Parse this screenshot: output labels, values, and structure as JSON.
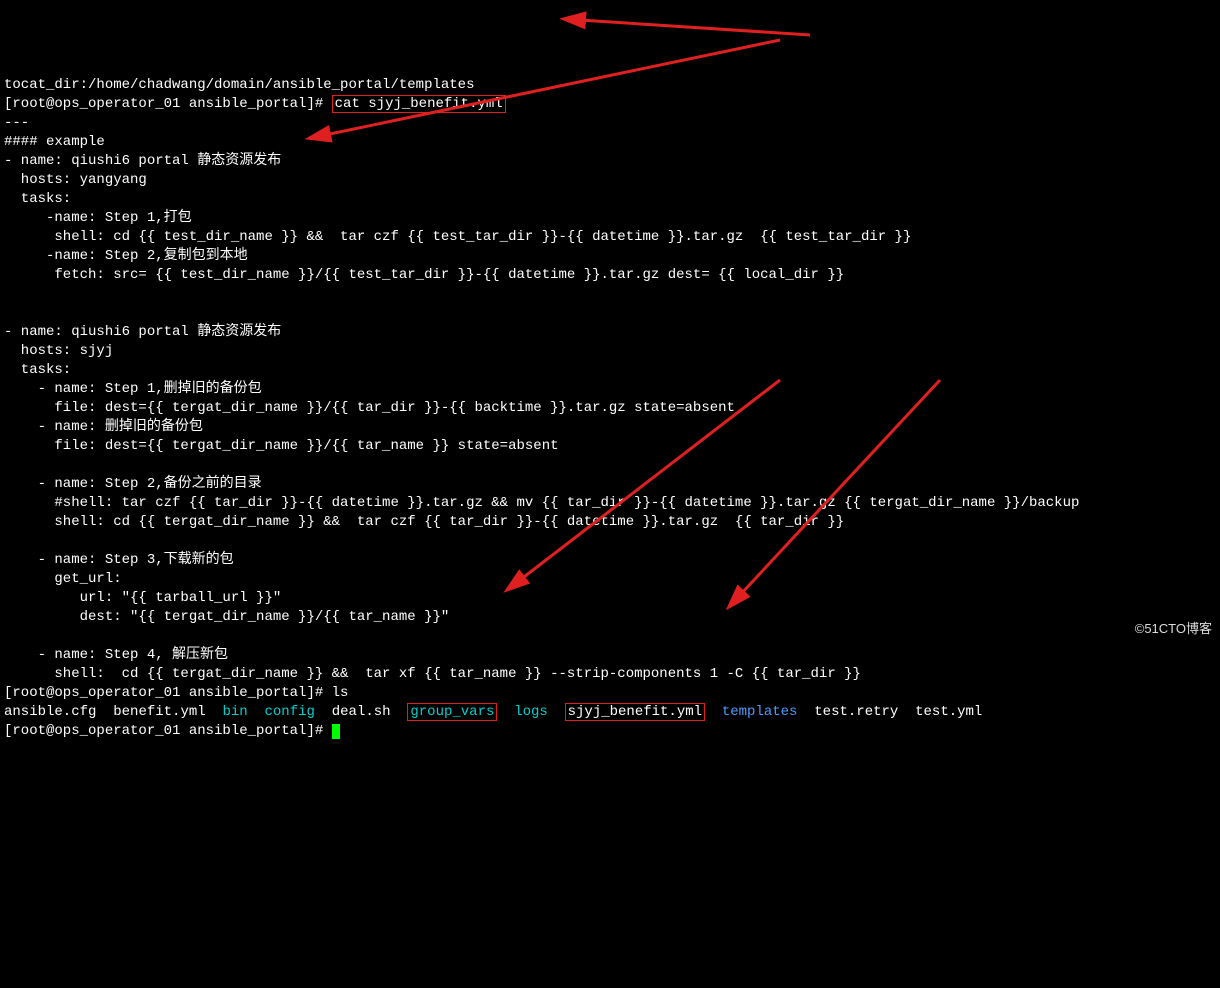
{
  "lines": {
    "l0": "tocat_dir:/home/chadwang/domain/ansible_portal/templates",
    "prompt_pre": "[root@ops_operator_01 ansible_portal]# ",
    "cmd1": "cat sjyj_benefit.yml",
    "l2": "---",
    "l3": "#### example",
    "l4": "- name: qiushi6 portal 静态资源发布",
    "l5": "  hosts: yangyang",
    "l6": "  tasks:",
    "l7": "     -name: Step 1,打包",
    "l8": "      shell: cd {{ test_dir_name }} &&  tar czf {{ test_tar_dir }}-{{ datetime }}.tar.gz  {{ test_tar_dir }}",
    "l9": "     -name: Step 2,复制包到本地",
    "l10": "      fetch: src= {{ test_dir_name }}/{{ test_tar_dir }}-{{ datetime }}.tar.gz dest= {{ local_dir }}",
    "l12": "- name: qiushi6 portal 静态资源发布",
    "l13": "  hosts: sjyj",
    "l14": "  tasks:",
    "l15": "    - name: Step 1,删掉旧的备份包",
    "l16": "      file: dest={{ tergat_dir_name }}/{{ tar_dir }}-{{ backtime }}.tar.gz state=absent",
    "l17": "    - name: 删掉旧的备份包",
    "l18": "      file: dest={{ tergat_dir_name }}/{{ tar_name }} state=absent",
    "l20": "    - name: Step 2,备份之前的目录",
    "l21": "      #shell: tar czf {{ tar_dir }}-{{ datetime }}.tar.gz && mv {{ tar_dir }}-{{ datetime }}.tar.gz {{ tergat_dir_name }}/backup",
    "l22": "      shell: cd {{ tergat_dir_name }} &&  tar czf {{ tar_dir }}-{{ datetime }}.tar.gz  {{ tar_dir }}",
    "l24": "    - name: Step 3,下载新的包",
    "l25": "      get_url:",
    "l26": "         url: \"{{ tarball_url }}\"",
    "l27": "         dest: \"{{ tergat_dir_name }}/{{ tar_name }}\"",
    "l29": "    - name: Step 4, 解压新包",
    "l30": "      shell:  cd {{ tergat_dir_name }} &&  tar xf {{ tar_name }} --strip-components 1 -C {{ tar_dir }}",
    "cmd2": "ls",
    "ls": {
      "f1": "ansible.cfg",
      "f2": "benefit.yml",
      "d1": "bin",
      "d2": "config",
      "f3": "deal.sh",
      "d3": "group_vars",
      "d4": "logs",
      "f4": "sjyj_benefit.yml",
      "d5": "templates",
      "f5": "test.retry",
      "f6": "test.yml"
    }
  },
  "watermark": "©51CTO博客"
}
